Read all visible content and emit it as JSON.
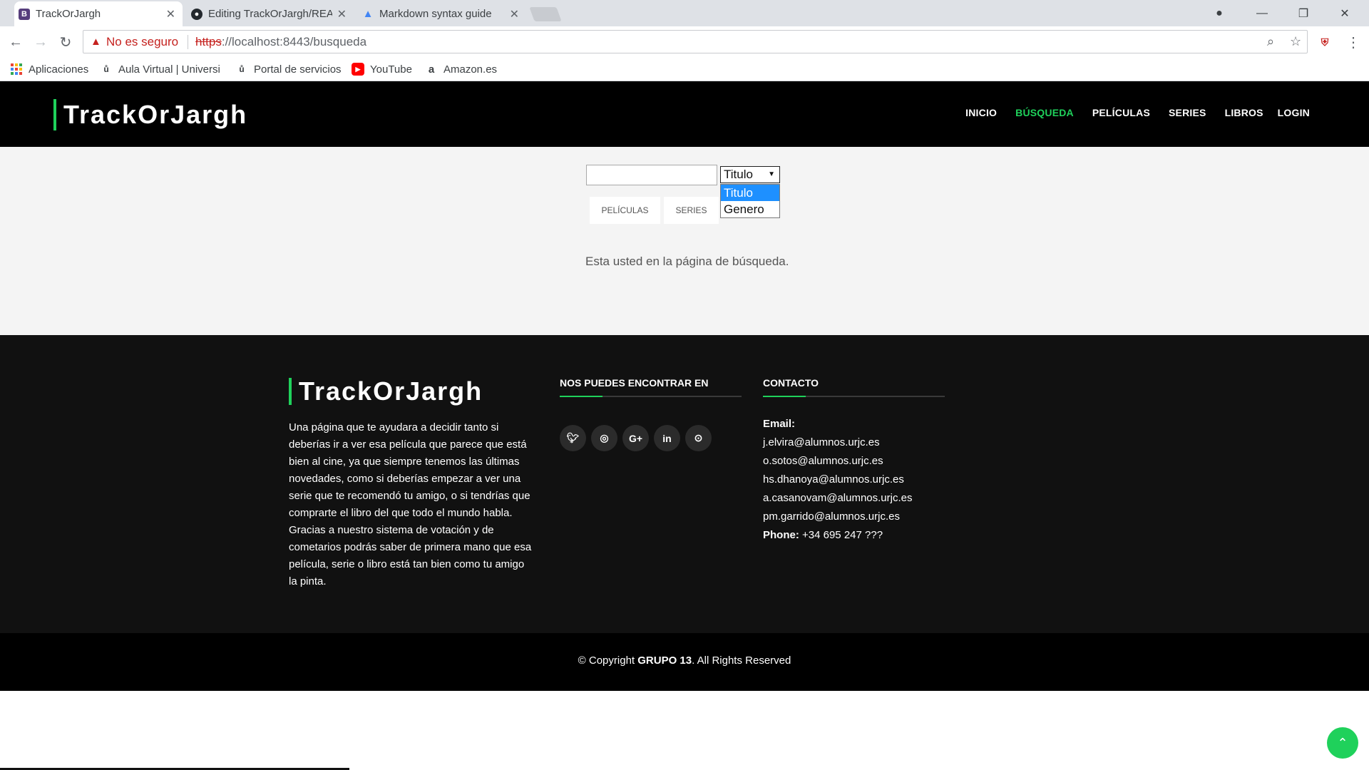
{
  "browser": {
    "tabs": [
      {
        "title": "TrackOrJargh",
        "favicon": "B"
      },
      {
        "title": "Editing TrackOrJargh/README",
        "favicon": "github"
      },
      {
        "title": "Markdown syntax guide",
        "favicon": "A"
      }
    ],
    "security_label": "No es seguro",
    "url_scheme": "https",
    "url_rest": "://localhost:8443/busqueda",
    "bookmarks": [
      {
        "label": "Aplicaciones",
        "icon": "apps-grid-icon"
      },
      {
        "label": "Aula Virtual | Universi",
        "icon": "urjc-icon"
      },
      {
        "label": "Portal de servicios",
        "icon": "urjc-icon"
      },
      {
        "label": "YouTube",
        "icon": "youtube-icon"
      },
      {
        "label": "Amazon.es",
        "icon": "amazon-icon"
      }
    ]
  },
  "site": {
    "logo": "TrackOrJargh",
    "nav": [
      {
        "label": "INICIO",
        "active": false
      },
      {
        "label": "BÚSQUEDA",
        "active": true
      },
      {
        "label": "PELÍCULAS",
        "active": false
      },
      {
        "label": "SERIES",
        "active": false
      },
      {
        "label": "LIBROS",
        "active": false
      },
      {
        "label": "LOGIN",
        "active": false
      }
    ],
    "accent_color": "#1fd15b"
  },
  "search": {
    "input_value": "",
    "select_value": "Titulo",
    "options": [
      "Titulo",
      "Genero"
    ],
    "filters": [
      "PELÍCULAS",
      "SERIES"
    ],
    "info": "Esta usted en la página de búsqueda."
  },
  "footer": {
    "logo": "TrackOrJargh",
    "description": "Una página que te ayudara a decidir tanto si deberías ir a ver esa película que parece que está bien al cine, ya que siempre tenemos las últimas novedades, como si deberías empezar a ver una serie que te recomendó tu amigo, o si tendrías que comprarte el libro del que todo el mundo habla. Gracias a nuestro sistema de votación y de cometarios podrás saber de primera mano que esa película, serie o libro está tan bien como tu amigo la pinta.",
    "social_title": "NOS PUEDES ENCONTRAR EN",
    "social": [
      "twitter-icon",
      "instagram-icon",
      "google-plus-icon",
      "linkedin-icon",
      "github-icon"
    ],
    "contact_title": "CONTACTO",
    "email_label": "Email:",
    "emails": [
      "j.elvira@alumnos.urjc.es",
      "o.sotos@alumnos.urjc.es",
      "hs.dhanoya@alumnos.urjc.es",
      "a.casanovam@alumnos.urjc.es",
      "pm.garrido@alumnos.urjc.es"
    ],
    "phone_label": "Phone:",
    "phone": "+34 695 247 ???",
    "copyright_prefix": "© Copyright ",
    "copyright_group": "GRUPO 13",
    "copyright_suffix": ". All Rights Reserved"
  }
}
